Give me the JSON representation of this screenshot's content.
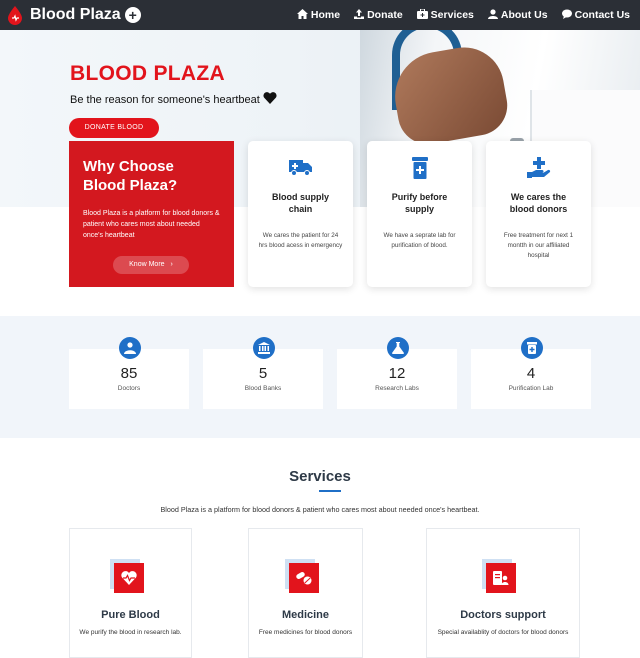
{
  "brand": {
    "name": "Blood Plaza",
    "plus": "+"
  },
  "nav": [
    {
      "label": "Home",
      "icon": "home-icon"
    },
    {
      "label": "Donate",
      "icon": "upload-icon"
    },
    {
      "label": "Services",
      "icon": "medkit-icon"
    },
    {
      "label": "About Us",
      "icon": "user-icon"
    },
    {
      "label": "Contact Us",
      "icon": "chat-icon"
    }
  ],
  "hero": {
    "title": "BLOOD PLAZA",
    "subtitle": "Be the reason for someone's heartbeat",
    "donate_label": "DONATE BLOOD"
  },
  "why": {
    "title": "Why Choose Blood Plaza?",
    "text": "Blood Plaza is a platform for blood donors & patient who cares most about needed once's heartbeat",
    "button": "Know More",
    "button_arrow": "›"
  },
  "features": [
    {
      "title": "Blood supply chain",
      "desc": "We cares the patient for 24 hrs blood acess in emergency",
      "icon": "ambulance-icon"
    },
    {
      "title": "Purify before supply",
      "desc": "We have a seprate lab for purification of blood.",
      "icon": "prescription-bottle-icon"
    },
    {
      "title": "We cares the blood donors",
      "desc": "Free treatment for next 1 montth in our affiliated hospital",
      "icon": "hand-holding-medical-icon"
    }
  ],
  "stats": [
    {
      "value": "85",
      "label": "Doctors",
      "icon": "doctor-icon"
    },
    {
      "value": "5",
      "label": "Blood Banks",
      "icon": "bank-icon"
    },
    {
      "value": "12",
      "label": "Research Labs",
      "icon": "flask-icon"
    },
    {
      "value": "4",
      "label": "Purification Lab",
      "icon": "bottle-icon"
    }
  ],
  "services": {
    "title": "Services",
    "desc": "Blood Plaza is a platform for blood donors & patient who cares most about needed once's heartbeat.",
    "items": [
      {
        "title": "Pure Blood",
        "desc": "We purify the blood in research lab.",
        "icon": "heartbeat-icon"
      },
      {
        "title": "Medicine",
        "desc": "Free medicines for blood donors",
        "icon": "pills-icon"
      },
      {
        "title": "Doctors support",
        "desc": "Special availablity of doctors for blood donors",
        "icon": "doctor-support-icon"
      }
    ]
  },
  "colors": {
    "accent_red": "#e2141c",
    "navy": "#2b2f36",
    "blue": "#1f6fc7"
  }
}
